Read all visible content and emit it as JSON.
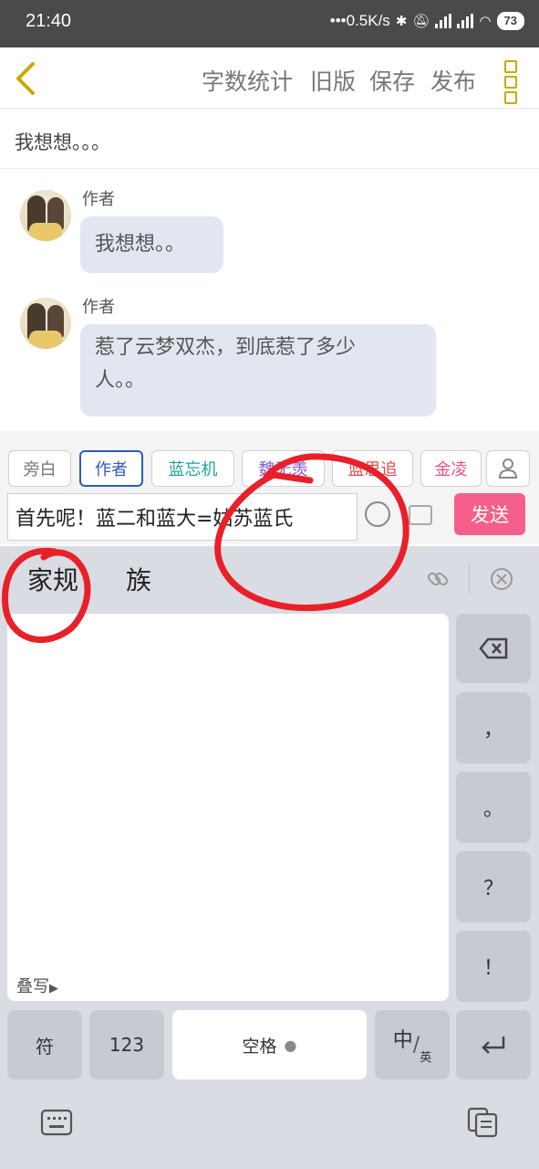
{
  "status_bar": {
    "time": "21:40",
    "network_speed": "•••0.5K/s",
    "battery": "73",
    "icons": [
      "bluetooth-icon",
      "mute-icon",
      "hd-icon",
      "signal-icon",
      "signal-icon",
      "wifi-icon",
      "battery-icon"
    ]
  },
  "top_bar": {
    "back_icon": "chevron-left-icon",
    "actions": [
      "字数统计",
      "旧版",
      "保存",
      "发布"
    ],
    "menu_icon": "more-vertical-icon"
  },
  "story_title": "我想想。。。",
  "messages": [
    {
      "author": "作者",
      "text": "我想想。。"
    },
    {
      "author": "作者",
      "text_line1": "惹了云梦双杰，到底惹了多少",
      "text_line2": "人。。"
    }
  ],
  "roles": [
    "旁白",
    "作者",
    "蓝忘机",
    "魏无羡",
    "蓝思追",
    "金凌"
  ],
  "role_colors": [
    "#777777",
    "#2b5db8",
    "#21a0a0",
    "#8a5ad4",
    "#e24a4a",
    "#e8508a"
  ],
  "add_role_icon": "person-icon",
  "input": {
    "value": "首先呢！蓝二和蓝大=姑苏蓝氏"
  },
  "send_label": "发送",
  "keyboard": {
    "candidates": [
      "家规",
      "族"
    ],
    "stack_write_label": "叠写",
    "side_keys": [
      "backspace-icon",
      "，",
      "。",
      "？",
      "！"
    ],
    "bottom_keys": {
      "symbol": "符",
      "numbers": "123",
      "space": "空格",
      "lang_top": "中",
      "lang_bottom": "英"
    },
    "enter_icon": "enter-icon"
  },
  "nav": {
    "left_icon": "keyboard-icon",
    "right_icon": "clipboard-icon"
  },
  "colors": {
    "accent_gold": "#c9a900",
    "send_pink": "#f4608b",
    "bubble": "#e1e6f0",
    "annotation_red": "#e8202a"
  }
}
